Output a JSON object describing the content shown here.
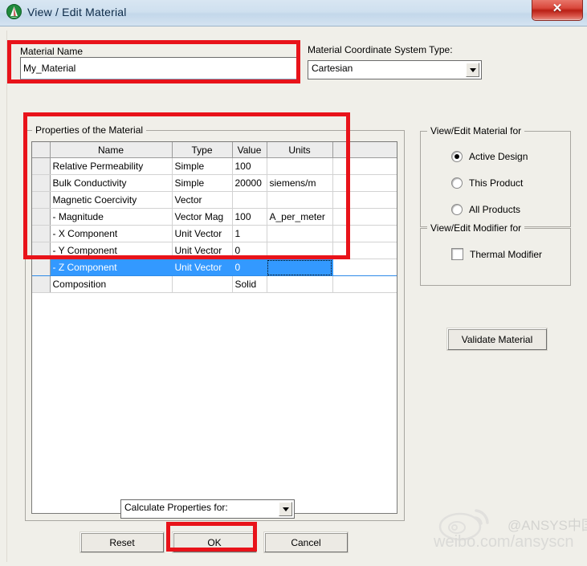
{
  "window": {
    "title": "View / Edit Material",
    "icon": "ansys-logo-icon",
    "close_label": "✕"
  },
  "material_name": {
    "label": "Material Name",
    "value": "My_Material",
    "placeholder": ""
  },
  "coordinate_system": {
    "label": "Material Coordinate System Type:",
    "value": "Cartesian"
  },
  "properties": {
    "group_title": "Properties of the Material",
    "columns": [
      "",
      "Name",
      "Type",
      "Value",
      "Units",
      ""
    ],
    "rows": [
      {
        "name": "Relative Permeability",
        "type": "Simple",
        "value": "100",
        "units": "",
        "selected": false
      },
      {
        "name": "Bulk Conductivity",
        "type": "Simple",
        "value": "20000",
        "units": "siemens/m",
        "selected": false
      },
      {
        "name": "Magnetic Coercivity",
        "type": "Vector",
        "value": "",
        "units": "",
        "selected": false
      },
      {
        "name": "-  Magnitude",
        "type": "Vector Mag",
        "value": "100",
        "units": "A_per_meter",
        "selected": false
      },
      {
        "name": "-  X Component",
        "type": "Unit Vector",
        "value": "1",
        "units": "",
        "selected": false
      },
      {
        "name": "-  Y Component",
        "type": "Unit Vector",
        "value": "0",
        "units": "",
        "selected": false
      },
      {
        "name": "-  Z Component",
        "type": "Unit Vector",
        "value": "0",
        "units": "",
        "selected": true
      },
      {
        "name": "Composition",
        "type": "",
        "value": "Solid",
        "units": "",
        "selected": false
      }
    ]
  },
  "view_edit_material_for": {
    "group_title": "View/Edit Material for",
    "options": [
      {
        "label": "Active Design",
        "checked": true
      },
      {
        "label": "This Product",
        "checked": false
      },
      {
        "label": "All Products",
        "checked": false
      }
    ]
  },
  "view_edit_modifier_for": {
    "group_title": "View/Edit Modifier for",
    "checkbox": {
      "label": "Thermal Modifier",
      "checked": false
    }
  },
  "validate_button": {
    "label": "Validate Material"
  },
  "calculate_properties": {
    "label": "Calculate Properties for:"
  },
  "footer_buttons": {
    "reset": "Reset",
    "ok": "OK",
    "cancel": "Cancel"
  },
  "watermark": {
    "handle": "@ANSYS中国",
    "url": "weibo.com/ansyscn"
  },
  "colors": {
    "annotation_red": "#e8131a",
    "selection_blue": "#3399ff",
    "titlebar_blue": "#cfe0ef",
    "close_red": "#b91f14",
    "dialog_face": "#f0efe9"
  }
}
